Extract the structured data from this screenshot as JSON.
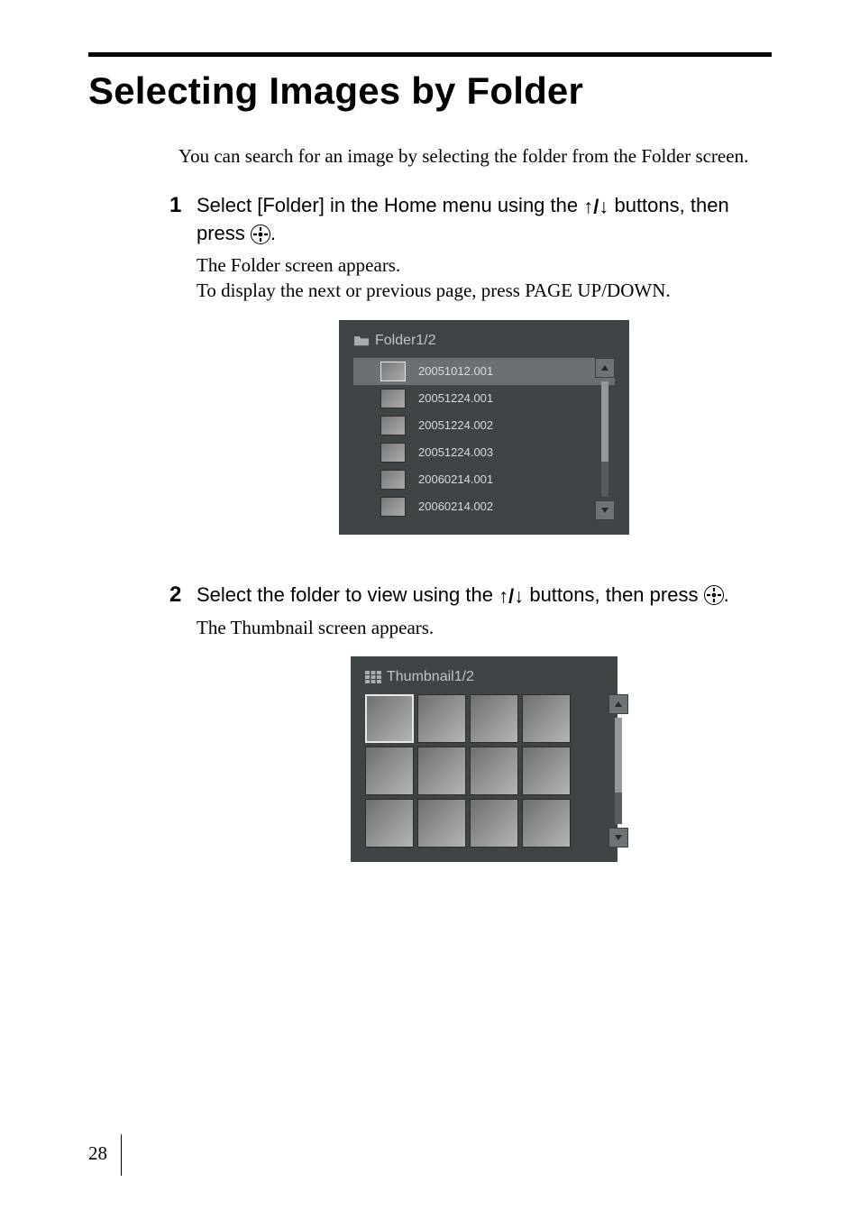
{
  "page_number": "28",
  "title": "Selecting Images by Folder",
  "intro": "You can search for an image by selecting the folder from the Folder screen.",
  "step1": {
    "num": "1",
    "head_a": "Select [Folder] in the Home menu using the ",
    "head_arrows": "↑/↓",
    "head_b": " buttons, then press ",
    "head_c": ".",
    "enter_icon_label": "enter-button-icon",
    "desc_a": "The Folder screen appears.",
    "desc_b": "To display the next or previous page, press PAGE UP/DOWN."
  },
  "folder_screen": {
    "title_prefix": "Folder ",
    "page_indicator": "1/2",
    "items": [
      {
        "name": "20051012.001",
        "selected": true
      },
      {
        "name": "20051224.001",
        "selected": false
      },
      {
        "name": "20051224.002",
        "selected": false
      },
      {
        "name": "20051224.003",
        "selected": false
      },
      {
        "name": "20060214.001",
        "selected": false
      },
      {
        "name": "20060214.002",
        "selected": false
      }
    ]
  },
  "step2": {
    "num": "2",
    "head_a": "Select the folder to view using the ",
    "head_arrows": "↑/↓",
    "head_b": " buttons, then press ",
    "head_c": ".",
    "desc": "The Thumbnail screen appears."
  },
  "thumbnail_screen": {
    "title_prefix": "Thumbnail ",
    "page_indicator": "1/2",
    "grid_count": 12,
    "selected_index": 0
  }
}
